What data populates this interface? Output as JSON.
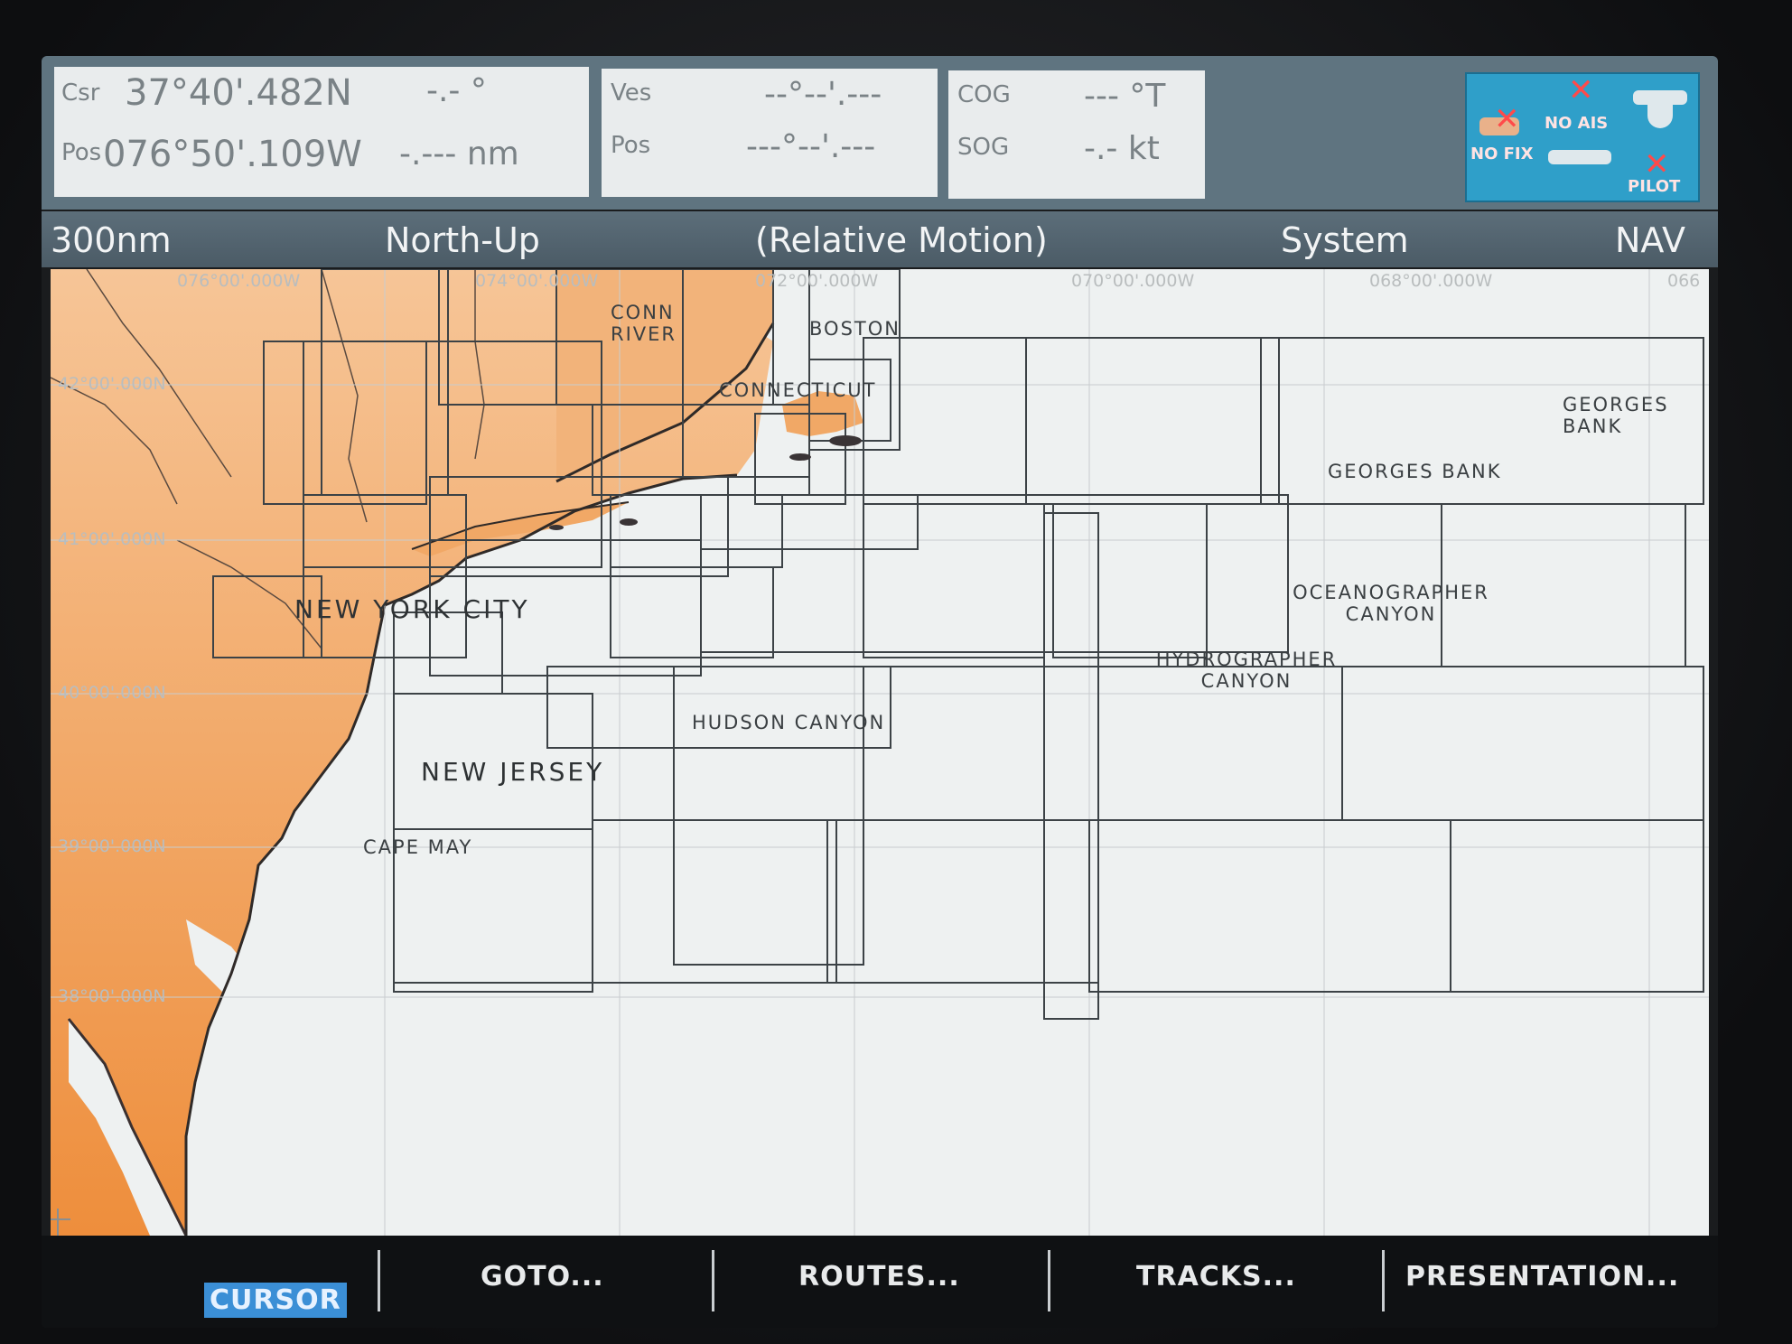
{
  "databar": {
    "csr_label": "Csr",
    "csr_lat": "37°40'.482N",
    "csr_bearing": "-.- °",
    "pos_label": "Pos",
    "pos_lon": "076°50'.109W",
    "pos_range": "-.--- nm",
    "ves_label": "Ves",
    "ves_value": "--°--'.---",
    "ves_pos_label": "Pos",
    "ves_pos_value": "---°--'.---",
    "cog_label": "COG",
    "cog_value": "--- °T",
    "sog_label": "SOG",
    "sog_value": "-.- kt"
  },
  "status_panel": {
    "no_fix": "NO FIX",
    "no_ais": "NO AIS",
    "pilot": "PILOT",
    "accent": "#2f9fc9",
    "alert_color": "#ff4a4a"
  },
  "status_strip": {
    "range": "300nm",
    "orientation": "North-Up",
    "motion": "(Relative Motion)",
    "system": "System",
    "mode": "NAV"
  },
  "chart": {
    "land_color": "#f0a356",
    "sea_color": "#eef1f1",
    "grid_labels": [
      "076°00'.000W",
      "074°00'.000W",
      "072°00'.000W",
      "070°00'.000W",
      "068°00'.000W",
      "066",
      "42°00'.000N",
      "41°00'.000N",
      "40°00'.000N",
      "39°00'.000N",
      "38°00'.000N"
    ],
    "place_labels": {
      "conn_river": "CONN RIVER",
      "boston": "BOSTON",
      "connecticut": "CONNECTICUT",
      "new_york": "NEW YORK CITY",
      "new_jersey": "NEW JERSEY",
      "cape_may": "CAPE MAY",
      "hudson_canyon": "HUDSON CANYON",
      "georges_bank_1": "GEORGES BANK",
      "georges_bank_2": "GEORGES BANK",
      "oceanographer": "OCEANOGRAPHER CANYON",
      "hydrographer": "HYDROGRAPHER CANYON"
    }
  },
  "softkeys": {
    "cursor": "CURSOR",
    "goto": "GOTO...",
    "routes": "ROUTES...",
    "tracks": "TRACKS...",
    "presentation": "PRESENTATION..."
  }
}
